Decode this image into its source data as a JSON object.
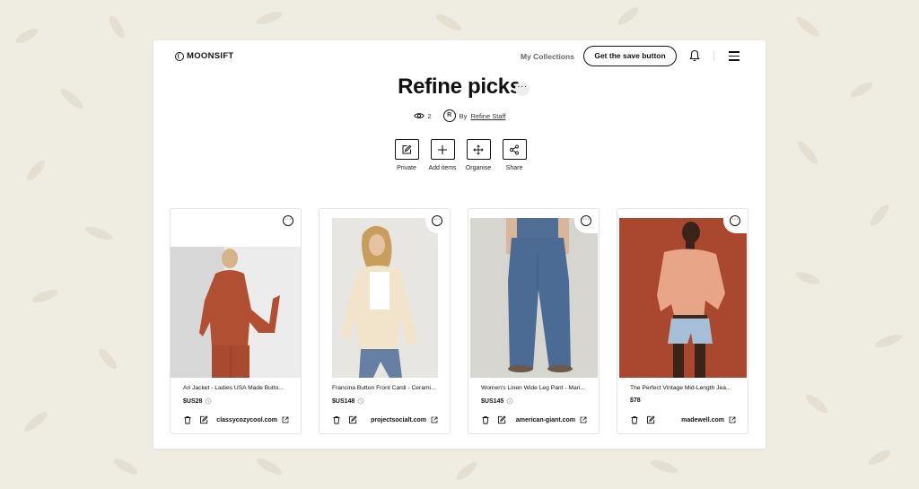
{
  "brand": {
    "name": "MOONSIFT"
  },
  "header": {
    "my_collections": "My Collections",
    "save_button": "Get the save button"
  },
  "collection": {
    "title": "Refine picks",
    "views": "2",
    "avatar_initial": "R",
    "by_label": "By",
    "author": "Refine Staff"
  },
  "actions": [
    {
      "label": "Private",
      "icon": "edit-icon"
    },
    {
      "label": "Add items",
      "icon": "plus-icon"
    },
    {
      "label": "Organise",
      "icon": "move-icon"
    },
    {
      "label": "Share",
      "icon": "share-icon"
    }
  ],
  "products": [
    {
      "title": "Ari Jacket - Ladies USA Made Butto...",
      "price": "$US28",
      "domain": "classycozycool.com",
      "has_history": true
    },
    {
      "title": "Francina Button Front Cardi - Cerami...",
      "price": "$US148",
      "domain": "projectsocialt.com",
      "has_history": true
    },
    {
      "title": "Women's Linen Wide Leg Pant - Mari...",
      "price": "$US145",
      "domain": "american-giant.com",
      "has_history": true
    },
    {
      "title": "The Perfect Vintage Mid-Length Jea...",
      "price": "$78",
      "domain": "madewell.com",
      "has_history": false
    }
  ],
  "colors": {
    "background": "#efece2",
    "leaf": "#e3dfd0",
    "text": "#111111"
  }
}
